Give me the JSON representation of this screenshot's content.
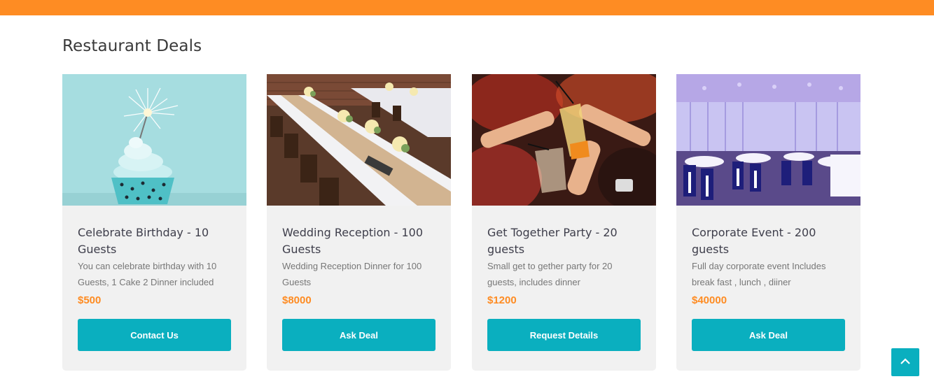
{
  "section": {
    "title": "Restaurant Deals"
  },
  "deals": [
    {
      "title": "Celebrate Birthday - 10 Guests",
      "description": "You can celebrate birthday with 10 Guests, 1 Cake 2 Dinner included",
      "price": "$500",
      "button": "Contact Us"
    },
    {
      "title": "Wedding Reception - 100 Guests",
      "description": "Wedding Reception Dinner for 100 Guests",
      "price": "$8000",
      "button": "Ask Deal"
    },
    {
      "title": "Get Together Party - 20 guests",
      "description": "Small get to gether party for 20 guests, includes dinner",
      "price": "$1200",
      "button": "Request Details"
    },
    {
      "title": "Corporate Event - 200 guests",
      "description": "Full day corporate event Includes break fast , lunch , diiner",
      "price": "$40000",
      "button": "Ask Deal"
    }
  ],
  "icons": {
    "scroll_top": "chevron-up-icon"
  },
  "colors": {
    "accent": "#fe8c23",
    "button": "#0aafbf",
    "card_bg": "#f1f1f1"
  }
}
